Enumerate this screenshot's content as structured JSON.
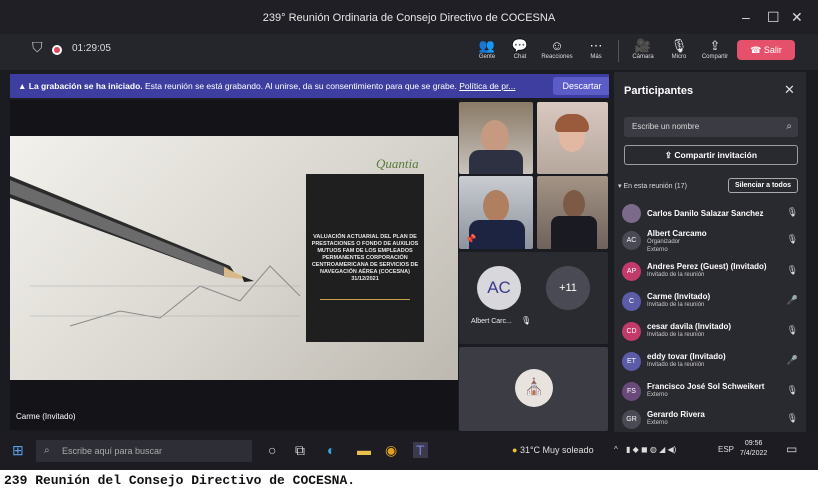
{
  "window": {
    "title": "239° Reunión Ordinaria de Consejo Directivo de COCESNA",
    "controls": [
      "–",
      "☐",
      "✕"
    ]
  },
  "toolbar": {
    "timer": "01:29:05",
    "buttons": [
      {
        "label": "Gente",
        "icon": "people-icon"
      },
      {
        "label": "Chat",
        "icon": "chat-icon"
      },
      {
        "label": "Reacciones",
        "icon": "reactions-icon"
      },
      {
        "label": "Más",
        "icon": "more-icon"
      },
      {
        "label": "Cámara",
        "icon": "camera-icon"
      },
      {
        "label": "Micro",
        "icon": "mic-icon"
      },
      {
        "label": "Compartir",
        "icon": "share-icon"
      }
    ],
    "leave": "Salir"
  },
  "banner": {
    "bold": "La grabación se ha iniciado.",
    "text": " Esta reunión se está grabando. Al unirse, da su consentimiento para que se grabe. ",
    "link": "Política de pr...",
    "dismiss": "Descartar"
  },
  "slide": {
    "logo": "Quantia",
    "doc_text": "VALUACIÓN ACTUARIAL DEL PLAN DE PRESTACIONES O FONDO DE AUXILIOS MUTUOS FAM DE LOS EMPLEADOS PERMANENTES CORPORACIÓN CENTROAMERICANA DE SERVICIOS DE NAVEGACIÓN AÉREA (COCESNA) 31/12/2021"
  },
  "presenter": "Carme (Invitado)",
  "tiles": {
    "avatar_initials": "AC",
    "avatar_name": "Albert Carc...",
    "overflow": "+11"
  },
  "panel": {
    "title": "Participantes",
    "search_placeholder": "Escribe un nombre",
    "share_invite": "Compartir invitación",
    "section": "En esta reunión (17)",
    "mute_all": "Silenciar a todos",
    "participants": [
      {
        "initials": "",
        "name": "Carlos Danilo Salazar Sanchez",
        "role": "",
        "color": "#7c6a8a"
      },
      {
        "initials": "AC",
        "name": "Albert Carcamo",
        "role": "Organizador",
        "role2": "Externo",
        "color": "#4a4a55"
      },
      {
        "initials": "AP",
        "name": "Andres Perez (Guest) (Invitado)",
        "role": "Invitado de la reunión",
        "color": "#c23a6a"
      },
      {
        "initials": "C",
        "name": "Carme (Invitado)",
        "role": "Invitado de la reunión",
        "color": "#5b5ba8"
      },
      {
        "initials": "CD",
        "name": "cesar davila (Invitado)",
        "role": "Invitado de la reunión",
        "color": "#c23a6a"
      },
      {
        "initials": "ET",
        "name": "eddy tovar (Invitado)",
        "role": "Invitado de la reunión",
        "color": "#5b5ba8"
      },
      {
        "initials": "FS",
        "name": "Francisco José Sol Schweikert",
        "role": "Externo",
        "color": "#6a4a7a"
      },
      {
        "initials": "GR",
        "name": "Gerardo Rivera",
        "role": "Externo",
        "color": "#4a4a55"
      }
    ]
  },
  "taskbar": {
    "search": "Escribe aquí para buscar",
    "weather": "31°C  Muy soleado",
    "lang": "ESP",
    "time": "09:56",
    "date": "7/4/2022"
  },
  "caption": "239 Reunión del Consejo Directivo de COCESNA."
}
